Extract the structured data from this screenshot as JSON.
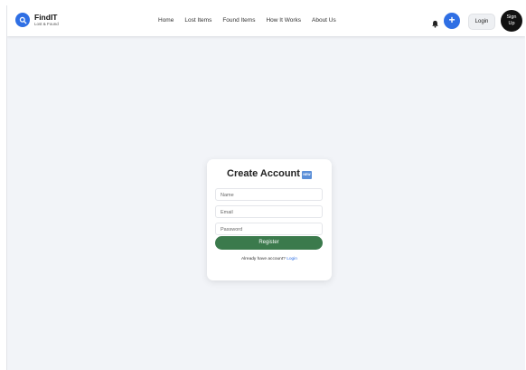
{
  "brand": {
    "name": "FindIT",
    "subtitle": "Lost & Found",
    "logo_icon": "search-icon",
    "accent": "#2f6fe4"
  },
  "nav": {
    "links": [
      "Home",
      "Lost Items",
      "Found Items",
      "How It Works",
      "About Us"
    ]
  },
  "actions": {
    "notification_icon": "bell-icon",
    "add_label": "+",
    "login_label": "Login",
    "signup_line1": "Sign",
    "signup_line2": "Up"
  },
  "form": {
    "title": "Create Account",
    "title_badge": "NEW",
    "fields": {
      "name_placeholder": "Name",
      "email_placeholder": "Email",
      "password_placeholder": "Password"
    },
    "submit_label": "Register",
    "submit_color": "#3b7a4c",
    "footer_text": "Already have account?",
    "footer_link": "Login"
  }
}
